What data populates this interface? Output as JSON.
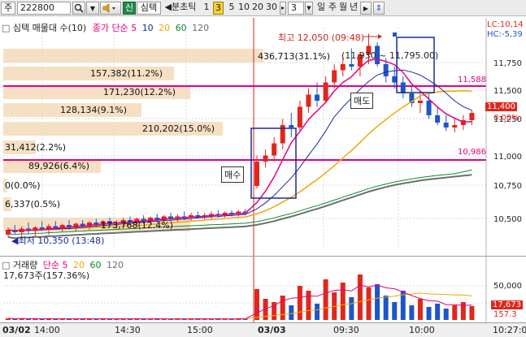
{
  "toolbar": {
    "market_label": "주",
    "stock_code": "222800",
    "signal_label": "신",
    "indicator_label": "심텍",
    "period_prefix": "◀분초틱",
    "intervals": [
      "1",
      "3",
      "5",
      "10",
      "20",
      "30"
    ],
    "selected_interval": "3",
    "unit_value": "3",
    "period_tabs": [
      "일",
      "주",
      "월",
      "년"
    ],
    "period_end_arrow": "▶"
  },
  "price_panel": {
    "legend_name": "심텍 매물대 수(10)",
    "legend_ma_label": "종가 단순",
    "ma_periods": [
      "5",
      "10",
      "20",
      "60",
      "120"
    ],
    "lc_label": "LC:10,14",
    "hc_label": "HC:-5,39",
    "high_annotation": "최고 12,050 (09:48)",
    "low_annotation": "최저 10,350 (13:48)",
    "line_labels": {
      "upper": "11,588",
      "lower": "10,986"
    },
    "current_price": "11,400",
    "current_change": "0.00%",
    "sell_label": "매도",
    "buy_label": "매수",
    "volume_profile": [
      "436,713(31.1%)",
      "157,382(11.2%)",
      "171,230(12.2%)",
      "128,134(9.1%)",
      "210,202(15.0%)",
      "31,412(2.2%)",
      "89,926(6.4%)",
      "0(0.0%)",
      "6,337(0.5%)",
      "173,768(12.4%)"
    ],
    "range_annotation": "(11,930 ~ 11,795.00)",
    "y_ticks": [
      "11,750",
      "11,500",
      "11,250",
      "11,000",
      "10,750",
      "10,500"
    ]
  },
  "volume_panel": {
    "legend_name": "거래량",
    "legend_ma_label": "단순",
    "ma_periods": [
      "5",
      "20",
      "60",
      "120"
    ],
    "volume_info": "17,673주(157.36%)",
    "y_tick": "50,000",
    "current_volume": "17,673",
    "current_ratio": "157.3"
  },
  "time_axis": {
    "labels": [
      "03/02",
      "14:00",
      "14:30",
      "15:00",
      "03/03",
      "09:30",
      "10:00",
      "10:27:0"
    ]
  },
  "colors": {
    "up_candle": "#e1261c",
    "down_candle": "#1e56c6",
    "ma5": "#e6007e",
    "ma10": "#1a2a9a",
    "ma20": "#f0a800",
    "ma60": "#0e8a2e",
    "ma120": "#6e6e6e",
    "profile_bar": "#f6e0c4"
  },
  "chart_data": {
    "type": "candlestick",
    "ylim": [
      10300,
      12100
    ],
    "candles": [
      [
        10400,
        10460,
        10380,
        10440
      ],
      [
        10440,
        10480,
        10400,
        10420
      ],
      [
        10420,
        10470,
        10390,
        10450
      ],
      [
        10450,
        10500,
        10410,
        10430
      ],
      [
        10430,
        10470,
        10380,
        10460
      ],
      [
        10460,
        10510,
        10430,
        10440
      ],
      [
        10440,
        10490,
        10400,
        10470
      ],
      [
        10470,
        10510,
        10440,
        10450
      ],
      [
        10450,
        10490,
        10420,
        10480
      ],
      [
        10480,
        10520,
        10440,
        10460
      ],
      [
        10460,
        10500,
        10430,
        10490
      ],
      [
        10490,
        10520,
        10450,
        10470
      ],
      [
        10470,
        10510,
        10440,
        10500
      ],
      [
        10500,
        10530,
        10460,
        10480
      ],
      [
        10480,
        10520,
        10450,
        10510
      ],
      [
        10510,
        10540,
        10470,
        10490
      ],
      [
        10490,
        10520,
        10450,
        10500
      ],
      [
        10500,
        10540,
        10470,
        10520
      ],
      [
        10520,
        10550,
        10480,
        10500
      ],
      [
        10500,
        10540,
        10470,
        10530
      ],
      [
        10530,
        10560,
        10490,
        10510
      ],
      [
        10510,
        10550,
        10480,
        10540
      ],
      [
        10540,
        10570,
        10500,
        10520
      ],
      [
        10520,
        10560,
        10490,
        10550
      ],
      [
        10550,
        10580,
        10510,
        10530
      ],
      [
        10530,
        10570,
        10500,
        10550
      ],
      [
        10550,
        10590,
        10520,
        10540
      ],
      [
        10540,
        10580,
        10510,
        10560
      ],
      [
        10560,
        10590,
        10530,
        10550
      ],
      [
        10550,
        10580,
        10520,
        10560
      ],
      [
        10560,
        10590,
        10530,
        10570
      ],
      [
        10570,
        10600,
        10540,
        10560
      ],
      [
        10560,
        10590,
        10540,
        10580
      ],
      [
        10580,
        10600,
        10550,
        10570
      ],
      [
        10570,
        10600,
        10550,
        10590
      ],
      [
        10590,
        10610,
        10560,
        10580
      ],
      [
        10800,
        11050,
        10780,
        11000
      ],
      [
        11000,
        11100,
        10950,
        11050
      ],
      [
        11050,
        11200,
        11000,
        11150
      ],
      [
        11150,
        11350,
        11100,
        11300
      ],
      [
        11300,
        11400,
        11200,
        11280
      ],
      [
        11280,
        11500,
        11250,
        11450
      ],
      [
        11450,
        11600,
        11400,
        11550
      ],
      [
        11550,
        11650,
        11450,
        11500
      ],
      [
        11500,
        11700,
        11480,
        11650
      ],
      [
        11650,
        11800,
        11600,
        11750
      ],
      [
        11750,
        11850,
        11700,
        11800
      ],
      [
        11800,
        11930,
        11750,
        11780
      ],
      [
        11780,
        11900,
        11700,
        11880
      ],
      [
        11880,
        12050,
        11800,
        11950
      ],
      [
        11950,
        11980,
        11780,
        11800
      ],
      [
        11800,
        11850,
        11650,
        11700
      ],
      [
        11700,
        11780,
        11600,
        11650
      ],
      [
        11650,
        11700,
        11520,
        11560
      ],
      [
        11560,
        11620,
        11450,
        11480
      ],
      [
        11480,
        11560,
        11400,
        11500
      ],
      [
        11500,
        11550,
        11350,
        11380
      ],
      [
        11380,
        11450,
        11300,
        11320
      ],
      [
        11320,
        11380,
        11250,
        11280
      ],
      [
        11280,
        11360,
        11240,
        11300
      ],
      [
        11300,
        11380,
        11260,
        11340
      ],
      [
        11340,
        11420,
        11300,
        11400
      ]
    ],
    "volumes": [
      2,
      1,
      2,
      1,
      2,
      1,
      2,
      1,
      1,
      2,
      1,
      2,
      1,
      1,
      2,
      1,
      2,
      1,
      1,
      2,
      1,
      1,
      2,
      1,
      1,
      2,
      1,
      1,
      2,
      1,
      1,
      2,
      1,
      1,
      2,
      1,
      38,
      26,
      22,
      30,
      18,
      42,
      36,
      20,
      50,
      34,
      46,
      28,
      56,
      40,
      44,
      30,
      22,
      36,
      18,
      26,
      16,
      20,
      14,
      18,
      22,
      17
    ]
  }
}
